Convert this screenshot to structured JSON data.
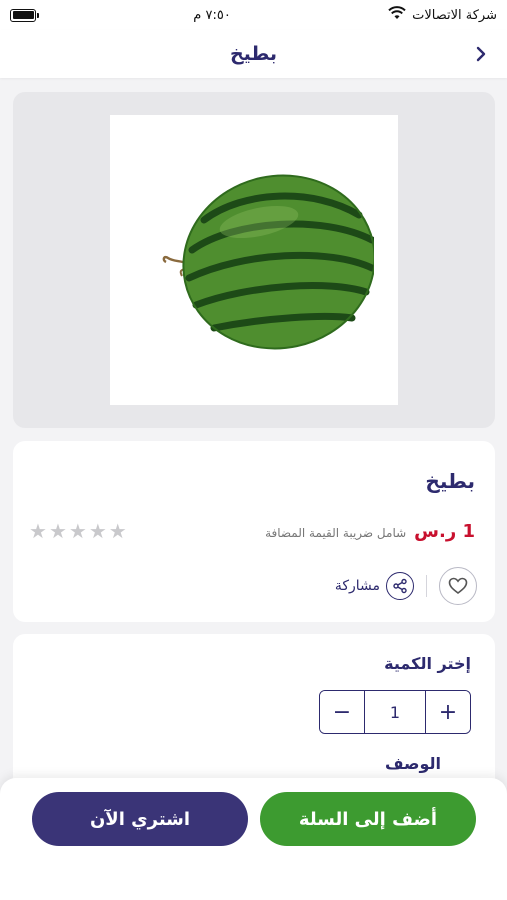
{
  "status_bar": {
    "carrier": "شركة الاتصالات",
    "time": "٧:٥٠ م"
  },
  "nav": {
    "title": "بطيخ"
  },
  "product": {
    "name": "بطيخ",
    "price": "1 ر.س",
    "vat_note": "شامل ضريبة القيمة المضافة",
    "rating": 0,
    "rating_max": 5,
    "share_label": "مشاركة",
    "image_icon": "watermelon-image"
  },
  "quantity": {
    "title": "إختر الكمية",
    "value": "1",
    "minus": "−",
    "plus": "+"
  },
  "description": {
    "title": "الوصف"
  },
  "actions": {
    "add_to_cart": "أضف إلى السلة",
    "buy_now": "اشتري الآن"
  },
  "colors": {
    "brand": "#2d2a6e",
    "price": "#c8102e",
    "cart_button": "#3d9b30",
    "buy_button": "#3a3477"
  }
}
